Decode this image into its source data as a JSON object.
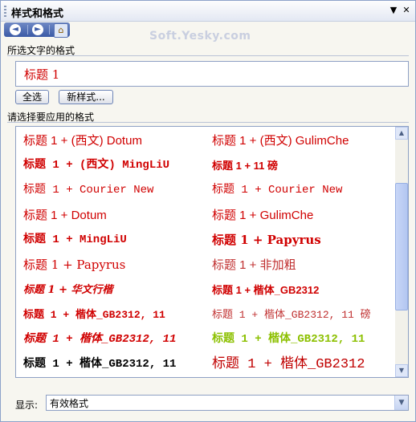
{
  "titlebar": {
    "title": "样式和格式",
    "dropdown_icon": "▼",
    "close_icon": "✕"
  },
  "navbar": {
    "back_icon": "◄",
    "forward_icon": "►",
    "home_icon": "⌂"
  },
  "watermark": "Soft.Yesky.com",
  "selected_section": {
    "label": "所选文字的格式",
    "value": "标题 1"
  },
  "buttons": {
    "select_all": "全选",
    "new_style": "新样式..."
  },
  "apply_section": {
    "label": "请选择要应用的格式"
  },
  "formats": [
    {
      "left": "标题 1 + (西文) Dotum",
      "right": "标题 1 + (西文) GulimChe"
    },
    {
      "left": "标题 1 + (西文) MingLiU",
      "right": "标题 1 + 11 磅"
    },
    {
      "left": "标题 1 + Courier New",
      "right": "标题 1 + Courier New"
    },
    {
      "left": "标题 1 + Dotum",
      "right": "标题 1 + GulimChe"
    },
    {
      "left": "标题 1 + MingLiU",
      "right": "标题 1 + Papyrus"
    },
    {
      "left": "标题 1 + Papyrus",
      "right": "标题 1 + 非加粗"
    },
    {
      "left": "标题 1 + 华文行楷",
      "right": "标题 1 + 楷体_GB2312"
    },
    {
      "left": "标题 1 + 楷体_GB2312, 11",
      "right": "标题 1 + 楷体_GB2312, 11 磅"
    },
    {
      "left": "标题 1 + 楷体_GB2312, 11",
      "right": "标题 1 + 楷体_GB2312, 11"
    },
    {
      "left": "标题 1 + 楷体_GB2312, 11",
      "right": "标题 1 + 楷体_GB2312"
    }
  ],
  "scrollbar": {
    "up_icon": "▲",
    "down_icon": "▼"
  },
  "show": {
    "label": "显示:",
    "value": "有效格式",
    "dropdown_icon": "▼"
  }
}
